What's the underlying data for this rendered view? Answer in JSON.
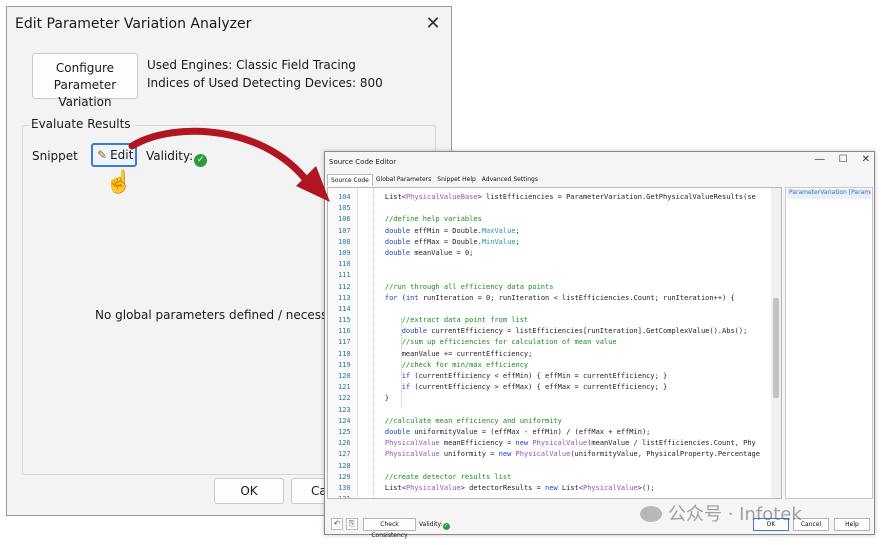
{
  "analyzer": {
    "title": "Edit Parameter Variation Analyzer",
    "close_glyph": "✕",
    "configure_button": [
      "Configure Parameter",
      "Variation"
    ],
    "used_engines": "Used Engines: Classic Field Tracing",
    "used_devices": "Indices of Used Detecting Devices: 800",
    "evaluate_results": "Evaluate Results",
    "snippet_label": "Snippet",
    "edit_label": "Edit",
    "validity_label": "Validity:",
    "no_params_message": "No global parameters defined / necessary in this",
    "ok_label": "OK",
    "cancel_label": "Ca"
  },
  "editor": {
    "title": "Source Code Editor",
    "tabs": [
      "Source Code",
      "Global Parameters",
      "Snippet Help",
      "Advanced Settings"
    ],
    "active_tab": "Source Code",
    "side_panel_header": "ParameterVariation [Paramete",
    "code": [
      {
        "n": "104",
        "text": "    List<PhysicalValueBase> listEfficiencies = ParameterVariation.GetPhysicalValueResults(se"
      },
      {
        "n": "105",
        "text": ""
      },
      {
        "n": "106",
        "text": "    //define help variables"
      },
      {
        "n": "107",
        "text": "    double effMin = Double.MaxValue;"
      },
      {
        "n": "108",
        "text": "    double effMax = Double.MinValue;"
      },
      {
        "n": "109",
        "text": "    double meanValue = 0;"
      },
      {
        "n": "110",
        "text": ""
      },
      {
        "n": "111",
        "text": ""
      },
      {
        "n": "112",
        "text": "    //run through all efficiency data points"
      },
      {
        "n": "113",
        "text": "    for (int runIteration = 0; runIteration < listEfficiencies.Count; runIteration++) {"
      },
      {
        "n": "114",
        "text": ""
      },
      {
        "n": "115",
        "text": "        //extract data point from list"
      },
      {
        "n": "116",
        "text": "        double currentEfficiency = listEfficiencies[runIteration].GetComplexValue().Abs();"
      },
      {
        "n": "117",
        "text": "        //sum up efficiencies for calculation of mean value"
      },
      {
        "n": "118",
        "text": "        meanValue += currentEfficiency;"
      },
      {
        "n": "119",
        "text": "        //check for min/max efficiency"
      },
      {
        "n": "120",
        "text": "        if (currentEfficiency < effMin) { effMin = currentEfficiency; }"
      },
      {
        "n": "121",
        "text": "        if (currentEfficiency > effMax) { effMax = currentEfficiency; }"
      },
      {
        "n": "122",
        "text": "    }"
      },
      {
        "n": "123",
        "text": ""
      },
      {
        "n": "124",
        "text": "    //calculate mean efficiency and uniformity"
      },
      {
        "n": "125",
        "text": "    double uniformityValue = (effMax - effMin) / (effMax + effMin);"
      },
      {
        "n": "126",
        "text": "    PhysicalValue meanEfficiency = new PhysicalValue(meanValue / listEfficiencies.Count, Phy"
      },
      {
        "n": "127",
        "text": "    PhysicalValue uniformity = new PhysicalValue(uniformityValue, PhysicalProperty.Percentage"
      },
      {
        "n": "128",
        "text": ""
      },
      {
        "n": "129",
        "text": "    //create detector results list"
      },
      {
        "n": "130",
        "text": "    List<PhysicalValue> detectorResults = new List<PhysicalValue>();"
      },
      {
        "n": "131",
        "text": ""
      }
    ],
    "check_consistency_label": "Check Consistency",
    "validity_label": "Validity:",
    "ok_label": "OK",
    "cancel_label": "Cancel",
    "help_label": "Help"
  },
  "watermark": "公众号 · Infotek",
  "colors": {
    "accent_blue": "#3a7bd5",
    "arrow_red": "#b01621",
    "valid_green": "#2e9b3a"
  }
}
